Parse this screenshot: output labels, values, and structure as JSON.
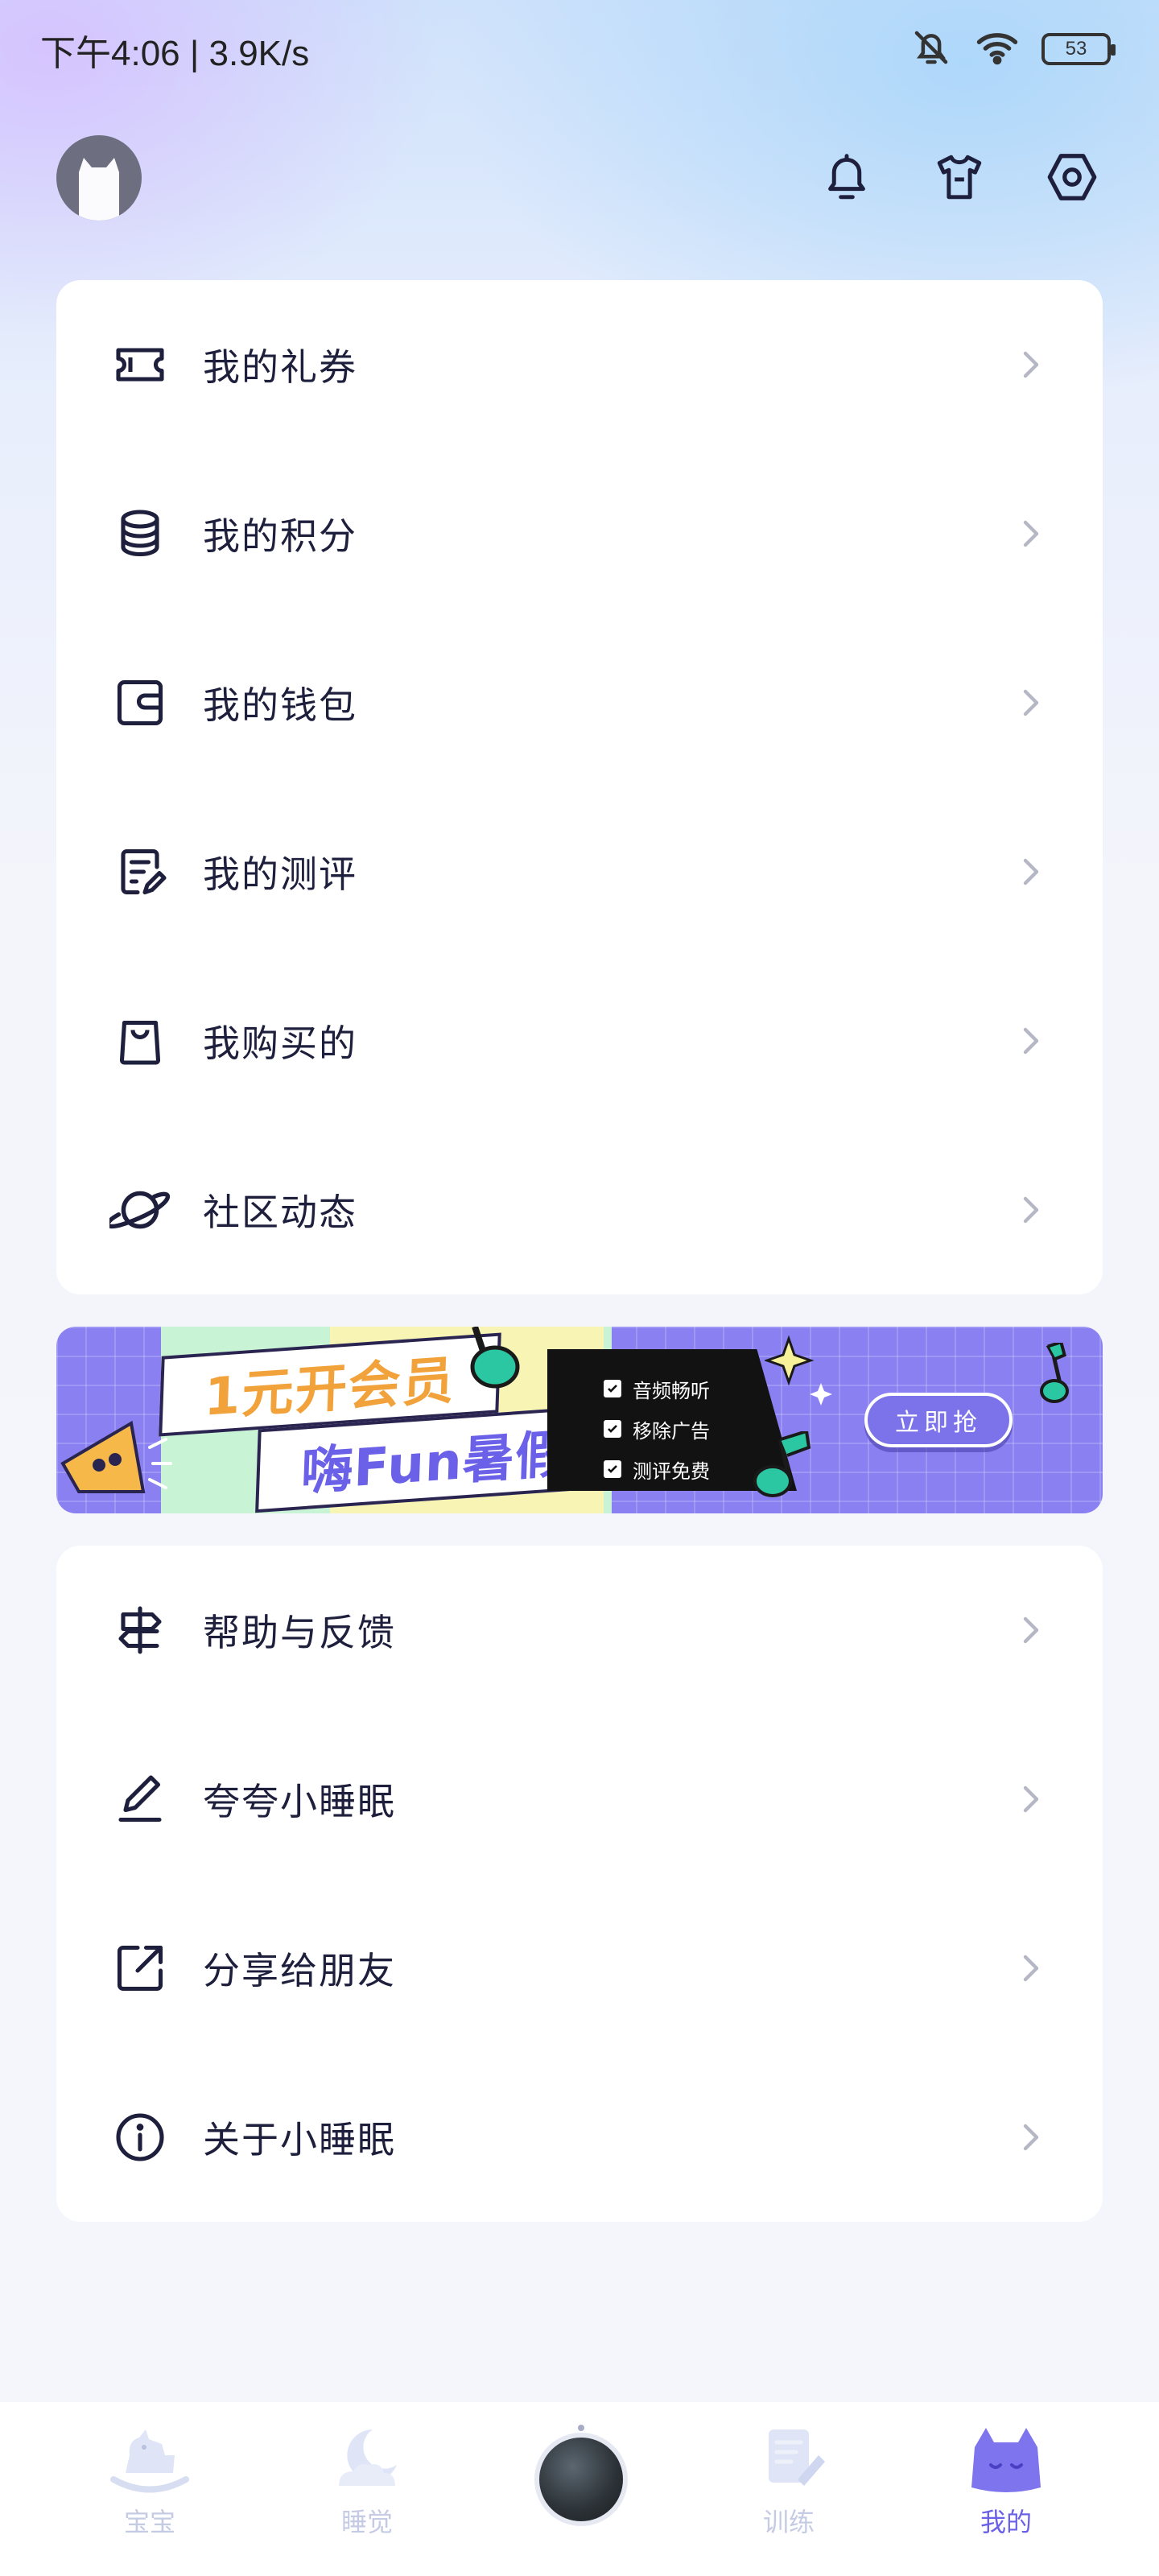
{
  "status_bar": {
    "text": "下午4:06 | 3.9K/s",
    "battery": "53"
  },
  "header": {
    "avatar": "avatar",
    "icons": [
      "bell-icon",
      "shirt-icon",
      "settings-icon"
    ]
  },
  "menu_group_1": [
    {
      "label": "我的礼券",
      "icon": "ticket-icon"
    },
    {
      "label": "我的积分",
      "icon": "coins-icon"
    },
    {
      "label": "我的钱包",
      "icon": "wallet-icon"
    },
    {
      "label": "我的测评",
      "icon": "assessment-icon"
    },
    {
      "label": "我购买的",
      "icon": "shopping-bag-icon"
    },
    {
      "label": "社区动态",
      "icon": "planet-icon"
    }
  ],
  "banner": {
    "title_1": "1元开会员",
    "title_2": "嗨Fun暑假",
    "features": [
      "音频畅听",
      "移除广告",
      "测评免费"
    ],
    "button": "立即抢"
  },
  "menu_group_2": [
    {
      "label": "帮助与反馈",
      "icon": "signpost-icon"
    },
    {
      "label": "夸夸小睡眠",
      "icon": "pen-icon"
    },
    {
      "label": "分享给朋友",
      "icon": "share-icon"
    },
    {
      "label": "关于小睡眠",
      "icon": "info-icon"
    }
  ],
  "bottom_nav": {
    "tabs": [
      {
        "label": "宝宝",
        "icon": "rocking-horse-icon"
      },
      {
        "label": "睡觉",
        "icon": "moon-cloud-icon"
      },
      {
        "label": "训练",
        "icon": "notebook-icon"
      },
      {
        "label": "我的",
        "icon": "cat-icon"
      }
    ],
    "active": "我的"
  },
  "colors": {
    "accent": "#6a61e6",
    "text": "#1e1f3c",
    "inactive_tab": "#c6cbe4",
    "banner_bg": "#8a80f2"
  }
}
